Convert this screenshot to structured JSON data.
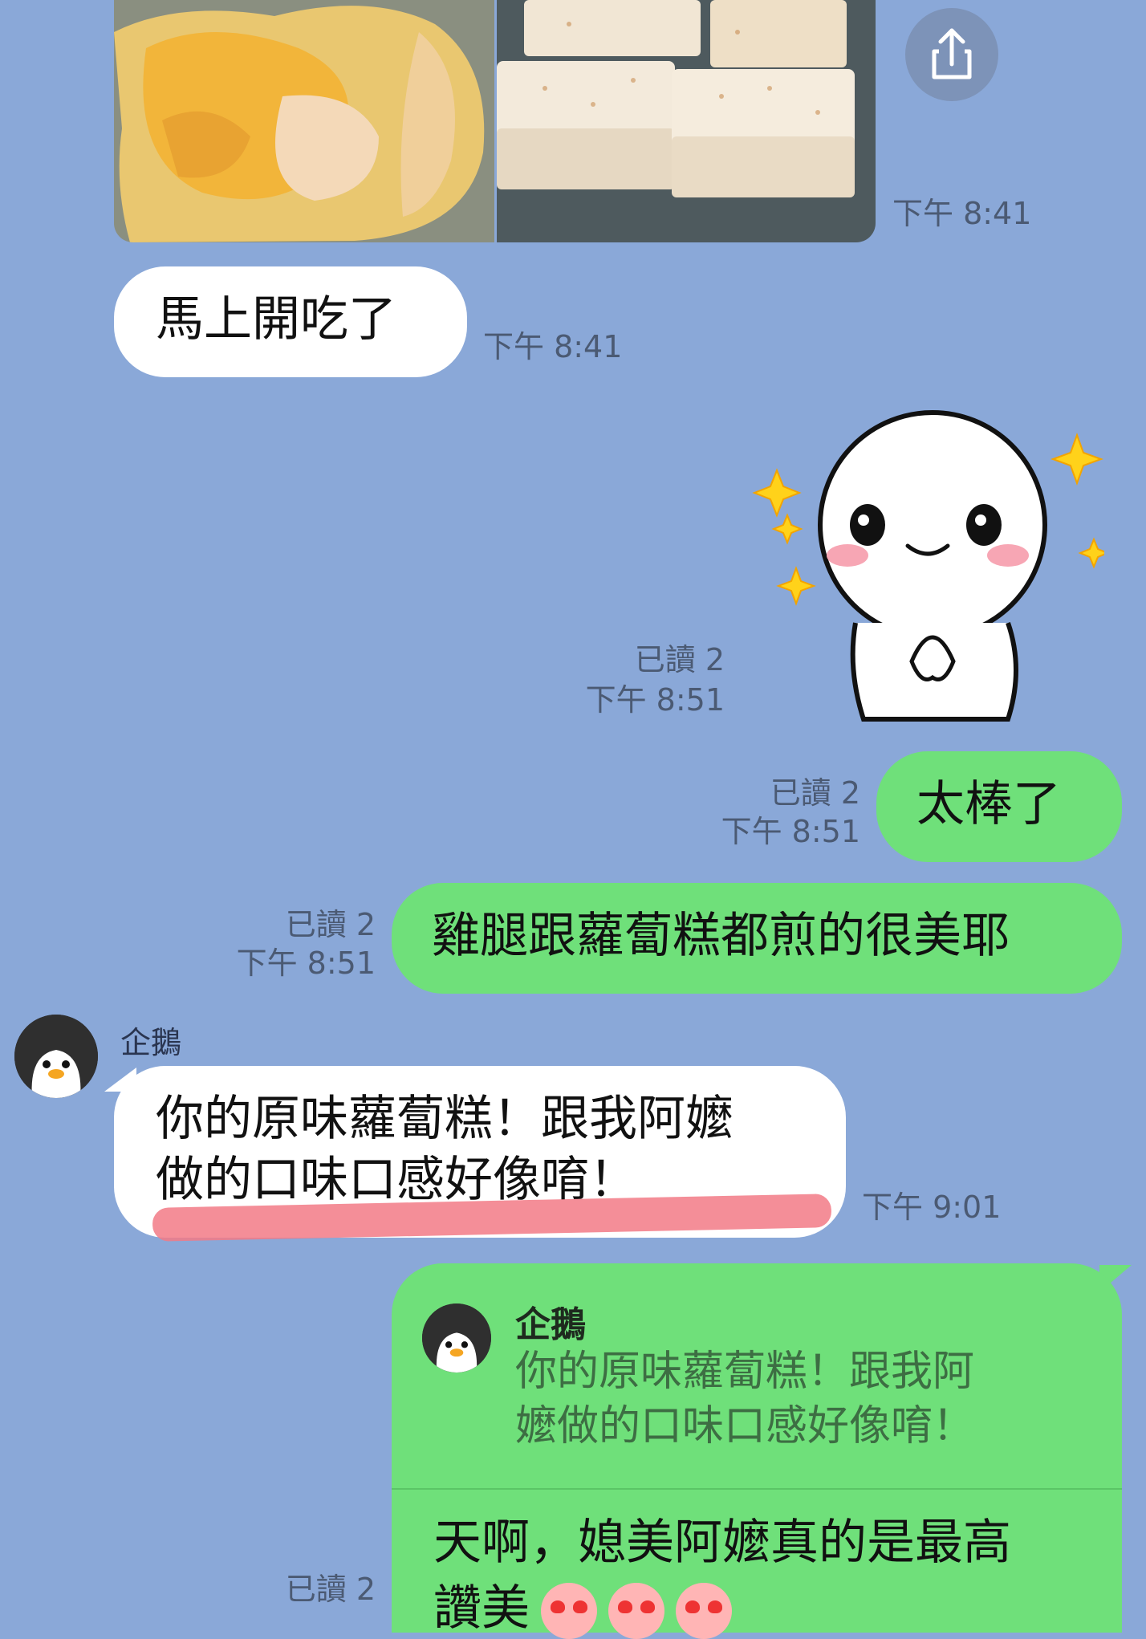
{
  "messages": {
    "photo": {
      "time": "下午 8:41"
    },
    "eating": {
      "text": "馬上開吃了",
      "time": "下午 8:41"
    },
    "sticker": {
      "read": "已讀 2",
      "time": "下午 8:51"
    },
    "great": {
      "text": "太棒了",
      "read": "已讀 2",
      "time": "下午 8:51"
    },
    "beautiful": {
      "text": "雞腿跟蘿蔔糕都煎的很美耶",
      "read": "已讀 2",
      "time": "下午 8:51"
    },
    "penguin_msg": {
      "sender": "企鵝",
      "line1": "你的原味蘿蔔糕！跟我阿嬤",
      "line2": "做的口味口感好像唷！",
      "time": "下午 9:01"
    },
    "reply": {
      "quote_sender": "企鵝",
      "quote_line1": "你的原味蘿蔔糕！跟我阿",
      "quote_line2": "嬤做的口味口感好像唷！",
      "line1": "天啊，媳美阿嬤真的是最高",
      "line2": "讚美",
      "read": "已讀 2"
    }
  },
  "icons": {
    "share": "share-icon",
    "avatar": "penguin-avatar",
    "emoji": "heart-eyes-emoji"
  },
  "colors": {
    "background": "#8aa8d8",
    "green_bubble": "#6fe07a",
    "white_bubble": "#ffffff",
    "highlight": "#f27a86"
  }
}
